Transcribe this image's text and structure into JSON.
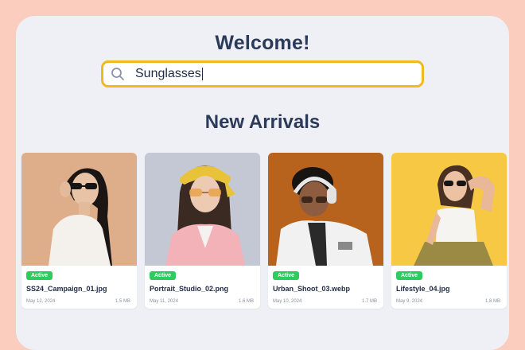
{
  "header": {
    "title": "Welcome!"
  },
  "search": {
    "value": "Sunglasses",
    "icon": "search-icon"
  },
  "section": {
    "title": "New Arrivals"
  },
  "cards": [
    {
      "status": "Active",
      "filename": "SS24_Campaign_01.jpg",
      "date": "May 12, 2024",
      "size": "1.5 MB"
    },
    {
      "status": "Active",
      "filename": "Portrait_Studio_02.png",
      "date": "May 11, 2024",
      "size": "1.6 MB"
    },
    {
      "status": "Active",
      "filename": "Urban_Shoot_03.webp",
      "date": "May 10, 2024",
      "size": "1.7 MB"
    },
    {
      "status": "Active",
      "filename": "Lifestyle_04.jpg",
      "date": "May 9, 2024",
      "size": "1.8 MB"
    }
  ],
  "colors": {
    "background": "#fbcdbf",
    "panel": "#eef0f6",
    "heading": "#2c3a5a",
    "search_border": "#f0b91e",
    "badge": "#2ecc5c"
  }
}
